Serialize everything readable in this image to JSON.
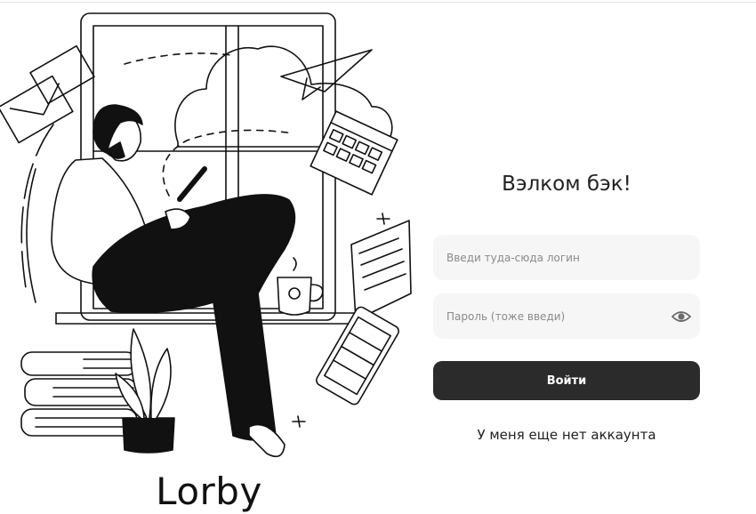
{
  "brand": {
    "name": "Lorby"
  },
  "login": {
    "title": "Вэлком бэк!",
    "login_placeholder": "Введи туда-сюда логин",
    "password_placeholder": "Пароль (тоже введи)",
    "submit_label": "Войти",
    "register_link": "У меня еще нет аккаунта",
    "password_toggle_icon": "eye-icon"
  },
  "colors": {
    "button_background": "#2b2b2b",
    "field_background": "#f6f6f6",
    "text": "#222222"
  }
}
